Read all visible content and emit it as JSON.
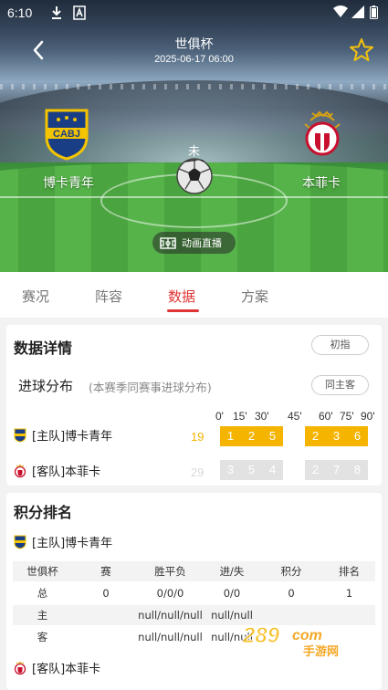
{
  "status_bar": {
    "time": "6:10"
  },
  "header": {
    "title": "世俱杯",
    "datetime": "2025-06-17 06:00",
    "status": "未",
    "home_team": "博卡青年",
    "away_team": "本菲卡",
    "home_logo_text": "CABJ",
    "live_button": "动画直播"
  },
  "tabs": [
    {
      "label": "赛况"
    },
    {
      "label": "阵容"
    },
    {
      "label": "数据"
    },
    {
      "label": "方案"
    }
  ],
  "data_detail": {
    "title": "数据详情",
    "odds_button": "初指",
    "goal_dist": {
      "title": "进球分布",
      "note": "(本赛季同赛事进球分布)",
      "filter_button": "同主客",
      "minutes": [
        "0'",
        "15'",
        "30'",
        "45'",
        "60'",
        "75'",
        "90'"
      ],
      "home": {
        "label": "[主队]博卡青年",
        "total": "19",
        "values": [
          "1",
          "2",
          "5",
          "2",
          "3",
          "6"
        ]
      },
      "away": {
        "label": "[客队]本菲卡",
        "total": "29",
        "values": [
          "3",
          "5",
          "4",
          "2",
          "7",
          "8"
        ]
      }
    }
  },
  "ranking": {
    "title": "积分排名",
    "home_label": "[主队]博卡青年",
    "away_label": "[客队]本菲卡",
    "headers": [
      "世俱杯",
      "赛",
      "胜平负",
      "进/失",
      "积分",
      "排名"
    ],
    "rows": [
      [
        "总",
        "0",
        "0/0/0",
        "0/0",
        "0",
        "1"
      ],
      [
        "主",
        "",
        "null/null/null",
        "null/null",
        "",
        ""
      ],
      [
        "客",
        "",
        "null/null/null",
        "null/null",
        "",
        ""
      ]
    ]
  },
  "watermark": {
    "brand": "289",
    "suffix": "com",
    "tagline": "手游网"
  },
  "colors": {
    "accent": "#e03434",
    "home_bar": "#f5b400",
    "away_bar": "#e2e2e2",
    "home_total": "#f5b400",
    "away_total": "#d9d9d9"
  }
}
